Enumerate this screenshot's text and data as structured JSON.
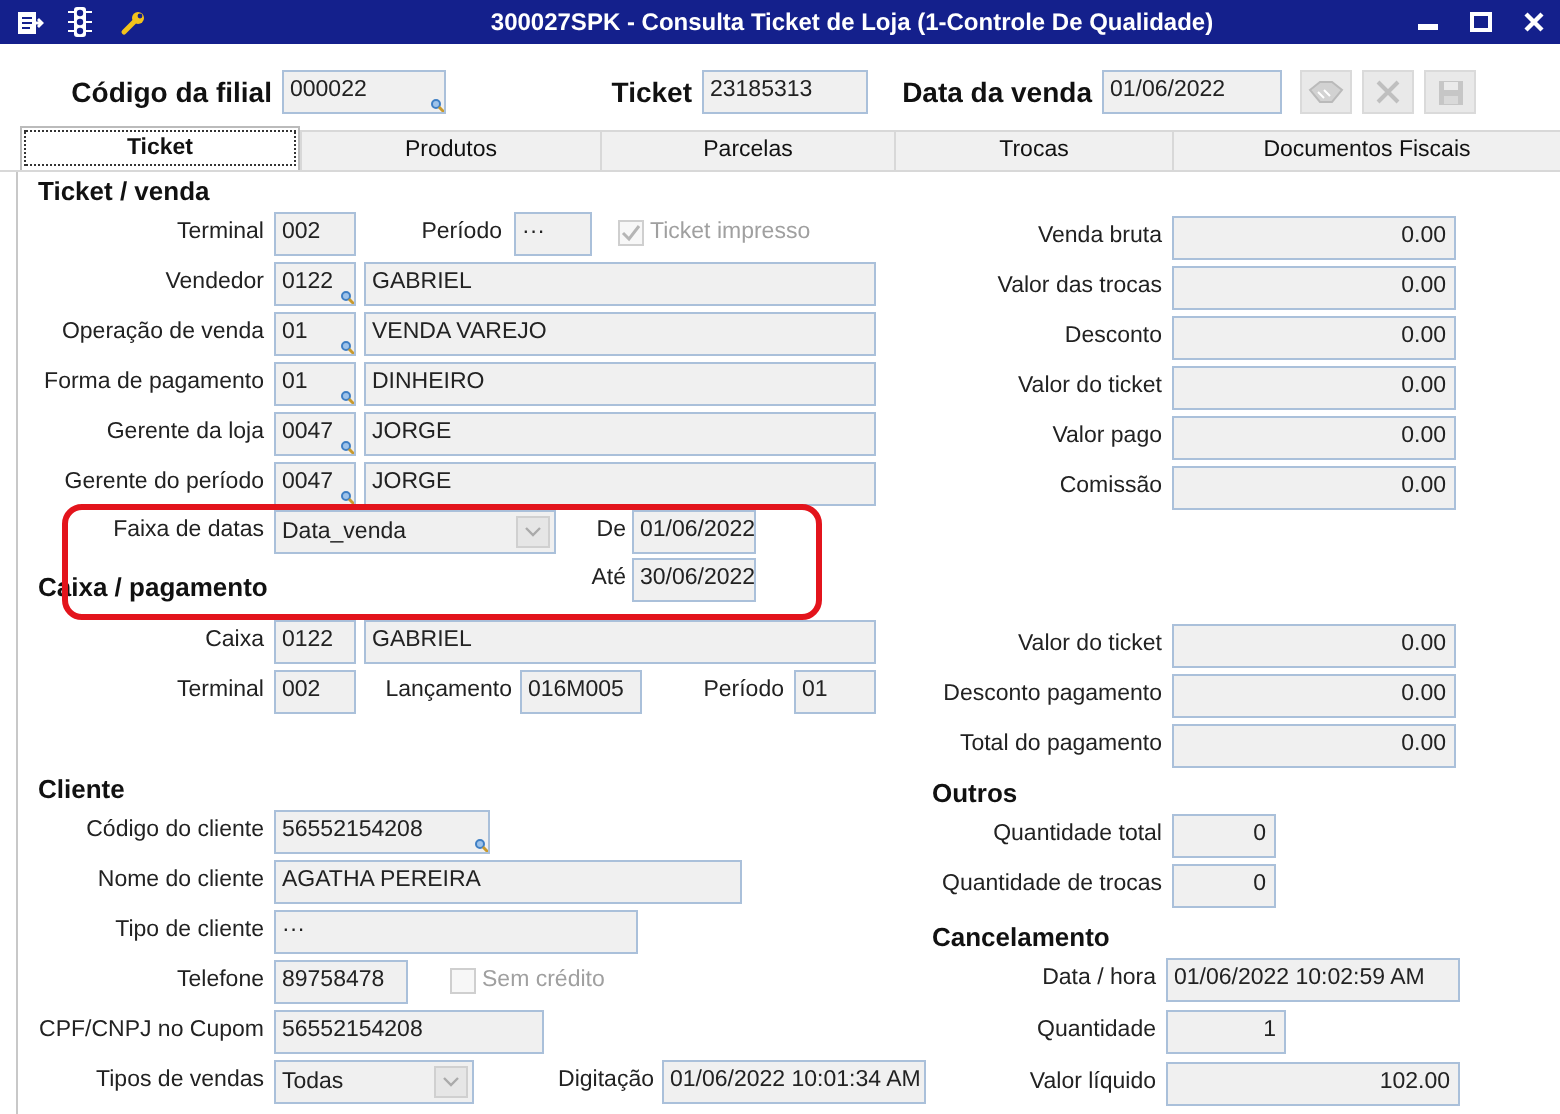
{
  "window": {
    "title": "300027SPK - Consulta Ticket de Loja (1-Controle De Qualidade)"
  },
  "header_fields": [
    {
      "label": "Código da filial",
      "value": "000022",
      "lookup": true
    },
    {
      "label": "Ticket",
      "value": "23185313",
      "lookup": false
    },
    {
      "label": "Data da venda",
      "value": "01/06/2022",
      "lookup": false
    }
  ],
  "header_buttons": [
    {
      "kind": "confirm",
      "disabled": true
    },
    {
      "kind": "cancel",
      "disabled": true
    },
    {
      "kind": "save",
      "disabled": true
    }
  ],
  "tabs": [
    {
      "label": "Ticket",
      "selected": true
    },
    {
      "label": "Produtos",
      "selected": false
    },
    {
      "label": "Parcelas",
      "selected": false
    },
    {
      "label": "Trocas",
      "selected": false
    },
    {
      "label": "Documentos Fiscais",
      "selected": false
    }
  ],
  "ticket_venda": {
    "title": "Ticket / venda",
    "terminal": {
      "label": "Terminal",
      "value": "002"
    },
    "periodo": {
      "label": "Período",
      "value": "···"
    },
    "ticket_impresso": {
      "label": "Ticket impresso",
      "checked": true,
      "disabled": true
    },
    "people": [
      {
        "label": "Vendedor",
        "code": "0122",
        "name": "GABRIEL",
        "lookup": true
      },
      {
        "label": "Operação de venda",
        "code": "01",
        "name": "VENDA VAREJO",
        "lookup": true
      },
      {
        "label": "Forma de pagamento",
        "code": "01",
        "name": "DINHEIRO",
        "lookup": true
      },
      {
        "label": "Gerente da loja",
        "code": "0047",
        "name": "JORGE",
        "lookup": true
      },
      {
        "label": "Gerente do período",
        "code": "0047",
        "name": "JORGE",
        "lookup": true
      }
    ],
    "faixa_de_datas": {
      "label": "Faixa de datas",
      "value": "Data_venda",
      "highlighted": true,
      "de": {
        "label": "De",
        "value": "01/06/2022"
      },
      "ate": {
        "label": "Até",
        "value": "30/06/2022"
      }
    }
  },
  "totals": [
    {
      "label": "Venda bruta",
      "value": "0.00"
    },
    {
      "label": "Valor das trocas",
      "value": "0.00"
    },
    {
      "label": "Desconto",
      "value": "0.00"
    },
    {
      "label": "Valor do ticket",
      "value": "0.00"
    },
    {
      "label": "Valor pago",
      "value": "0.00"
    },
    {
      "label": "Comissão",
      "value": "0.00"
    }
  ],
  "caixa_pagamento": {
    "title": "Caixa / pagamento",
    "caixa": {
      "label": "Caixa",
      "code": "0122",
      "name": "GABRIEL"
    },
    "terminal": {
      "label": "Terminal",
      "value": "002"
    },
    "lancamento": {
      "label": "Lançamento",
      "value": "016M005"
    },
    "periodo": {
      "label": "Período",
      "value": "01"
    }
  },
  "payment_totals": [
    {
      "label": "Valor do ticket",
      "value": "0.00"
    },
    {
      "label": "Desconto pagamento",
      "value": "0.00"
    },
    {
      "label": "Total do pagamento",
      "value": "0.00"
    }
  ],
  "cliente": {
    "title": "Cliente",
    "codigo": {
      "label": "Código do cliente",
      "value": "56552154208",
      "lookup": true
    },
    "nome": {
      "label": "Nome do cliente",
      "value": "AGATHA PEREIRA"
    },
    "tipo": {
      "label": "Tipo de cliente",
      "value": "···"
    },
    "telefone": {
      "label": "Telefone",
      "value": "89758478"
    },
    "sem_credito": {
      "label": "Sem crédito",
      "checked": false,
      "disabled": true
    },
    "cpf": {
      "label": "CPF/CNPJ no Cupom",
      "value": "56552154208"
    },
    "tipos_vendas": {
      "label": "Tipos de vendas",
      "value": "Todas"
    },
    "digitacao": {
      "label": "Digitação",
      "value": "01/06/2022 10:01:34 AM"
    }
  },
  "outros": {
    "title": "Outros",
    "items": [
      {
        "label": "Quantidade total",
        "value": "0"
      },
      {
        "label": "Quantidade de trocas",
        "value": "0"
      }
    ]
  },
  "cancelamento": {
    "title": "Cancelamento",
    "data_hora": {
      "label": "Data / hora",
      "value": "01/06/2022 10:02:59 AM"
    },
    "quantidade": {
      "label": "Quantidade",
      "value": "1"
    },
    "valor_liquido": {
      "label": "Valor líquido",
      "value": "102.00"
    }
  }
}
